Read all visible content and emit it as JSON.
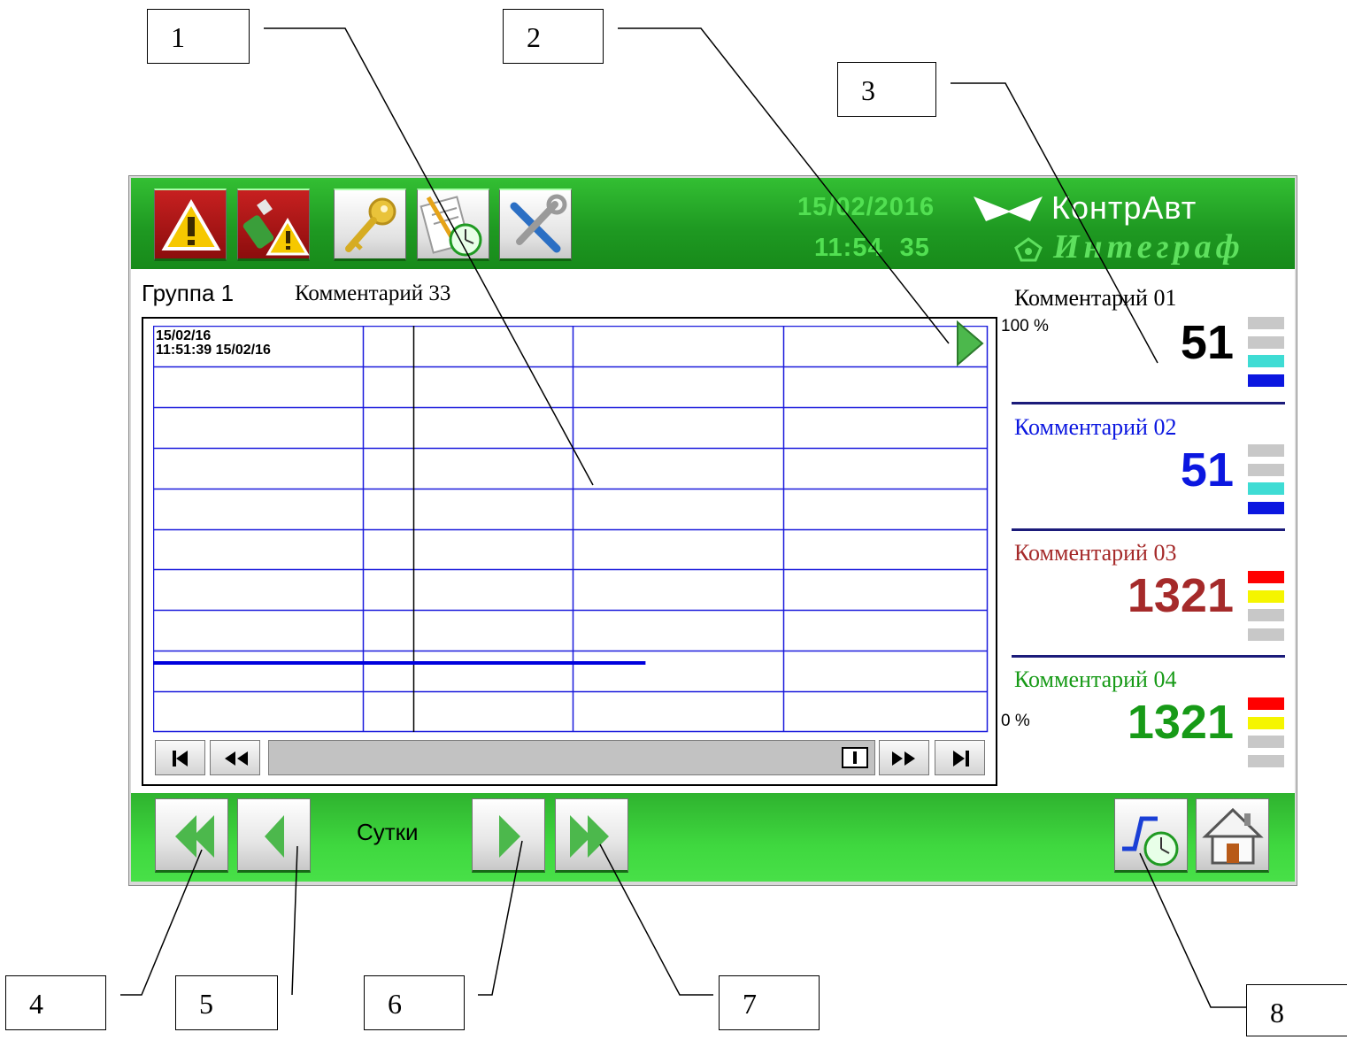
{
  "header": {
    "date": "15/02/2016",
    "time": "11:54 35",
    "brand_name": "КонтрАвт",
    "brand_product": "Интеграф"
  },
  "toolbar": {
    "buttons": [
      "alarm-icon",
      "usb-alarm-icon",
      "key-icon",
      "journal-clock-icon",
      "settings-tools-icon"
    ]
  },
  "group": {
    "title": "Группа 1",
    "comment": "Комментарий 33"
  },
  "chart": {
    "timestamp_date": "15/02/16",
    "timestamp_time_line": "11:51:39  15/02/16",
    "scale_max": "100 %",
    "scale_min": "0 %"
  },
  "chart_data": {
    "type": "line",
    "title": "",
    "xlabel": "",
    "ylabel": "",
    "ylim": [
      0,
      100
    ],
    "grid": true,
    "series": [
      {
        "color": "#0000dd",
        "x": [
          0,
          59
        ],
        "y": [
          17,
          17
        ]
      }
    ]
  },
  "channels": [
    {
      "label": "Комментарий 01",
      "value": "51",
      "color": "#000000",
      "levels": [
        "#c8c8c8",
        "#c8c8c8",
        "#3fdcd4",
        "#0b17e0"
      ]
    },
    {
      "label": "Комментарий 02",
      "value": "51",
      "color": "#0b17e0",
      "levels": [
        "#c8c8c8",
        "#c8c8c8",
        "#3fdcd4",
        "#0b17e0"
      ]
    },
    {
      "label": "Комментарий 03",
      "value": "1321",
      "color": "#a52a2a",
      "levels": [
        "#ff0000",
        "#f5f500",
        "#c8c8c8",
        "#c8c8c8"
      ]
    },
    {
      "label": "Комментарий 04",
      "value": "1321",
      "color": "#179a17",
      "levels": [
        "#ff0000",
        "#f5f500",
        "#c8c8c8",
        "#c8c8c8"
      ]
    }
  ],
  "footer": {
    "period_label": "Сутки"
  },
  "callouts": [
    "1",
    "2",
    "3",
    "4",
    "5",
    "6",
    "7",
    "8"
  ],
  "colors": {
    "bar_green": "#1f9a22",
    "grid_blue": "#1a1adc",
    "arrow_green": "#4cb84c"
  }
}
